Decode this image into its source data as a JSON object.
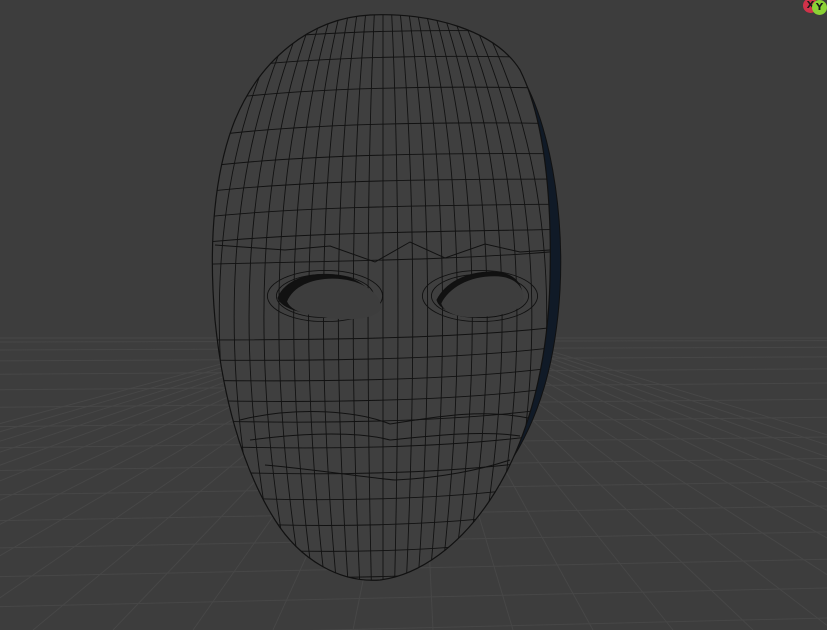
{
  "viewport": {
    "background": "#3d3d3d",
    "grid_color": "#474747",
    "wire_color": "#111111",
    "shadow_edge_color": "#101a27"
  },
  "gizmo": {
    "x_label": "X",
    "y_label": "Y",
    "x_color": "#d0324a",
    "y_color": "#8bd235"
  },
  "object": {
    "icon": "face-mask-mesh"
  }
}
